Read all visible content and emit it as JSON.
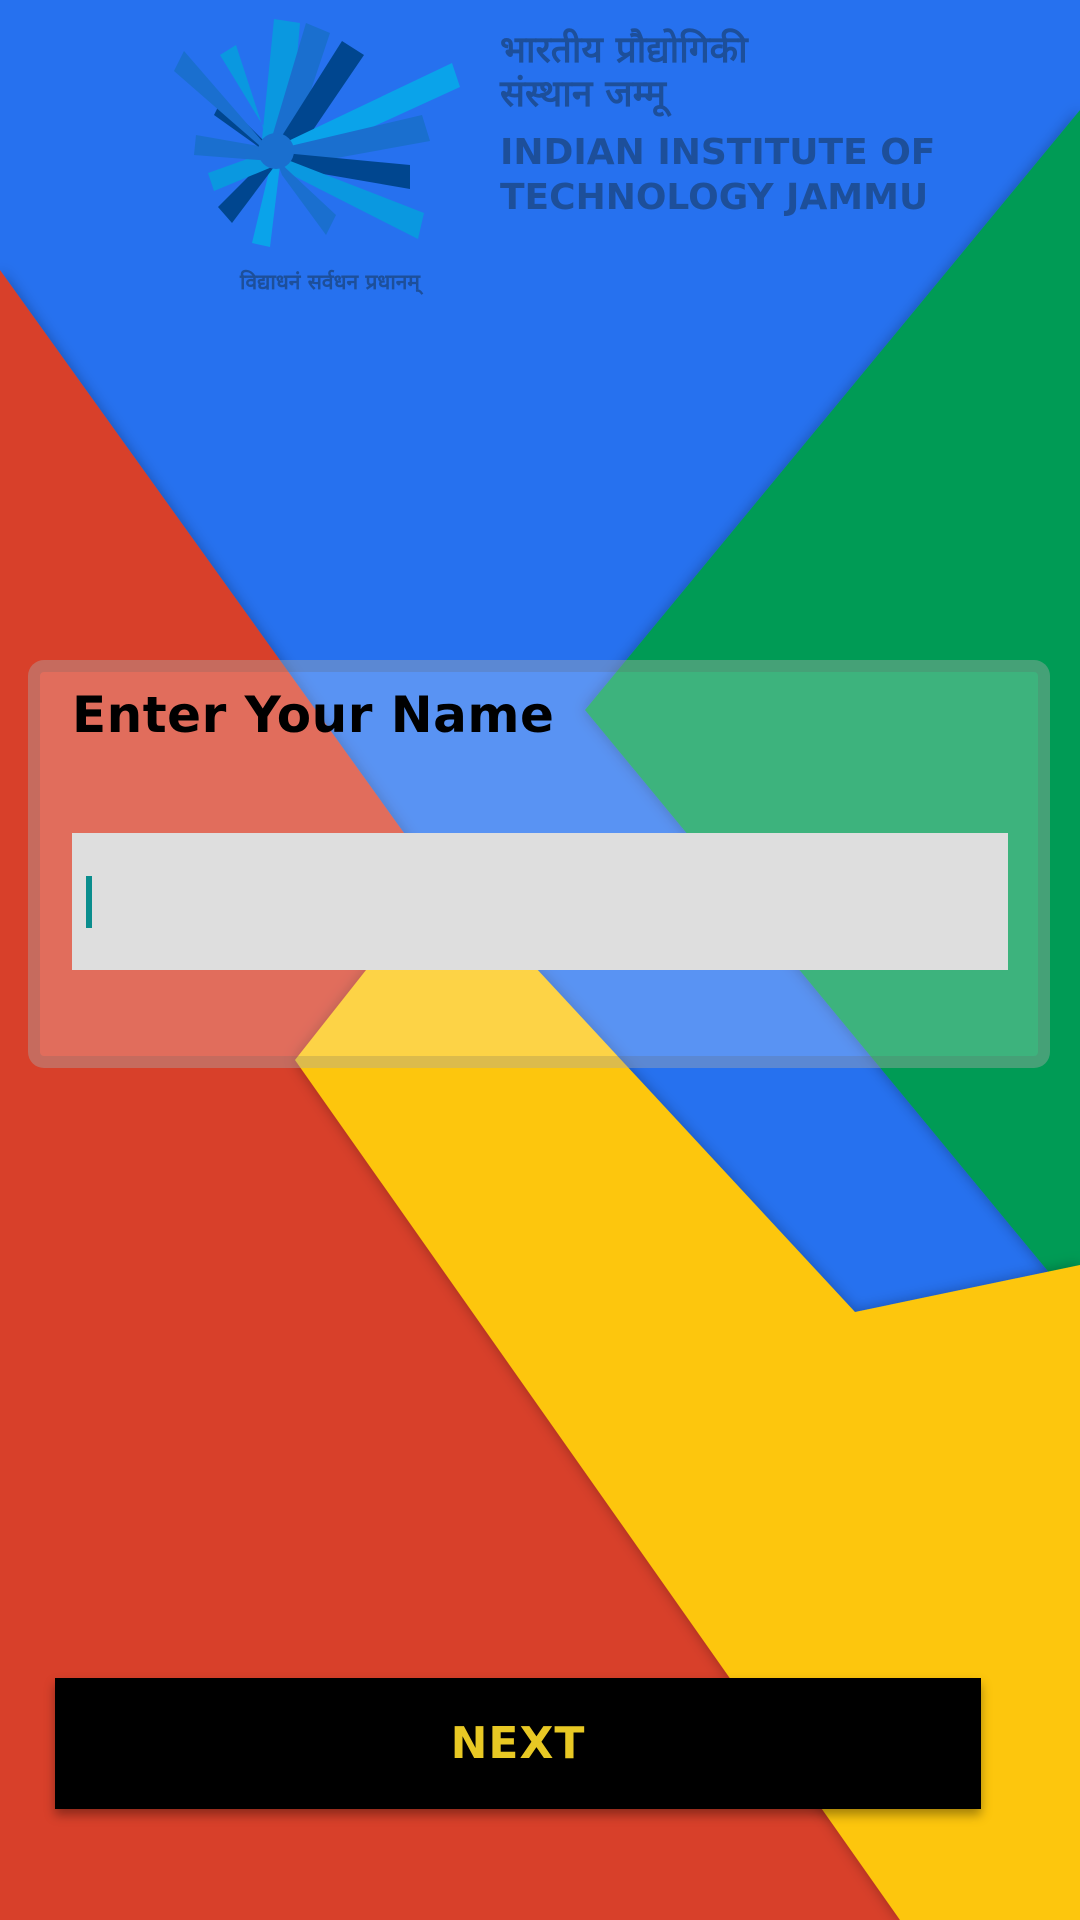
{
  "colors": {
    "background_blue": "#2671ef",
    "background_red": "#d8412b",
    "background_green": "#009b54",
    "background_yellow": "#fdc608",
    "logo_text": "#1d4f9a",
    "input_fill": "#dedede",
    "caret": "#0a8d8d",
    "button_fill": "#000000",
    "button_text": "#e8c824"
  },
  "header": {
    "logo_icon": "iit-jammu-emblem",
    "motto": "विद्याधनं सर्वधन प्रधानम्",
    "institute_hindi_line1": "भारतीय प्रौद्योगिकी",
    "institute_hindi_line2": "संस्थान जम्मू",
    "institute_english_line1": "INDIAN INSTITUTE OF",
    "institute_english_line2": "TECHNOLOGY JAMMU"
  },
  "form": {
    "title": "Enter Your Name",
    "name_value": "",
    "name_placeholder": ""
  },
  "actions": {
    "next_label": "NEXT"
  }
}
